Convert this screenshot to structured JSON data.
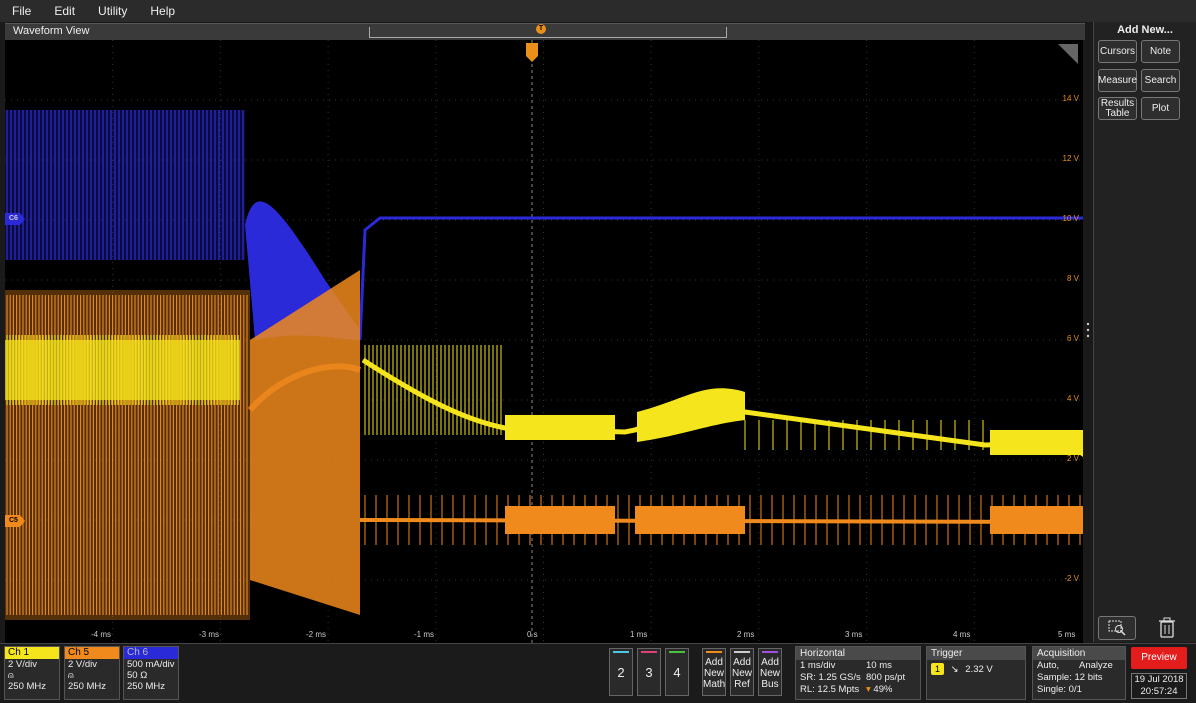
{
  "menu": [
    "File",
    "Edit",
    "Utility",
    "Help"
  ],
  "waveform_view": {
    "title": "Waveform View",
    "trigger_marker": "T"
  },
  "y_axis_labels": [
    "14 V",
    "12 V",
    "10 V",
    "8 V",
    "6 V",
    "4 V",
    "2 V",
    "0 V",
    "-2 V"
  ],
  "x_axis_labels": [
    "-4 ms",
    "-3 ms",
    "-2 ms",
    "-1 ms",
    "0 s",
    "1 ms",
    "2 ms",
    "3 ms",
    "4 ms",
    "5 ms"
  ],
  "channel_markers": {
    "c6": "C6",
    "c5": "C5"
  },
  "colors": {
    "ch1": "#f5e51c",
    "ch5": "#f08a1c",
    "ch6": "#2a2ad8",
    "trigger": "#e8901a",
    "preview": "#e31c1c"
  },
  "right_panel": {
    "title": "Add New...",
    "buttons": {
      "cursors": "Cursors",
      "note": "Note",
      "measure": "Measure",
      "search": "Search",
      "results_l1": "Results",
      "results_l2": "Table",
      "plot": "Plot"
    }
  },
  "channels": [
    {
      "name": "Ch 1",
      "scale": "2 V/div",
      "coupling_icon": "probe-icon",
      "bw": "250 MHz",
      "color": "#f5e51c"
    },
    {
      "name": "Ch 5",
      "scale": "2 V/div",
      "coupling_icon": "probe-icon",
      "bw": "250 MHz",
      "color": "#f08a1c"
    },
    {
      "name": "Ch 6",
      "scale": "500 mA/div",
      "imp": "50 Ω",
      "bw": "250 MHz",
      "color": "#2a2ad8"
    }
  ],
  "channel_buttons": [
    "2",
    "3",
    "4"
  ],
  "add_buttons": [
    {
      "l1": "Add",
      "l2": "New",
      "l3": "Math"
    },
    {
      "l1": "Add",
      "l2": "New",
      "l3": "Ref"
    },
    {
      "l1": "Add",
      "l2": "New",
      "l3": "Bus"
    }
  ],
  "horizontal": {
    "title": "Horizontal",
    "scale": "1 ms/div",
    "duration": "10 ms",
    "sr": "SR: 1.25 GS/s",
    "pts": "800 ps/pt",
    "rl": "RL: 12.5 Mpts",
    "pos": "49%"
  },
  "trigger": {
    "title": "Trigger",
    "source": "1",
    "slope": "↘",
    "level": "2.32 V"
  },
  "acquisition": {
    "title": "Acquisition",
    "mode": "Auto,",
    "action": "Analyze",
    "sample": "Sample: 12 bits",
    "single": "Single: 0/1"
  },
  "status": {
    "preview": "Preview",
    "date": "19 Jul 2018",
    "time": "20:57:24"
  }
}
